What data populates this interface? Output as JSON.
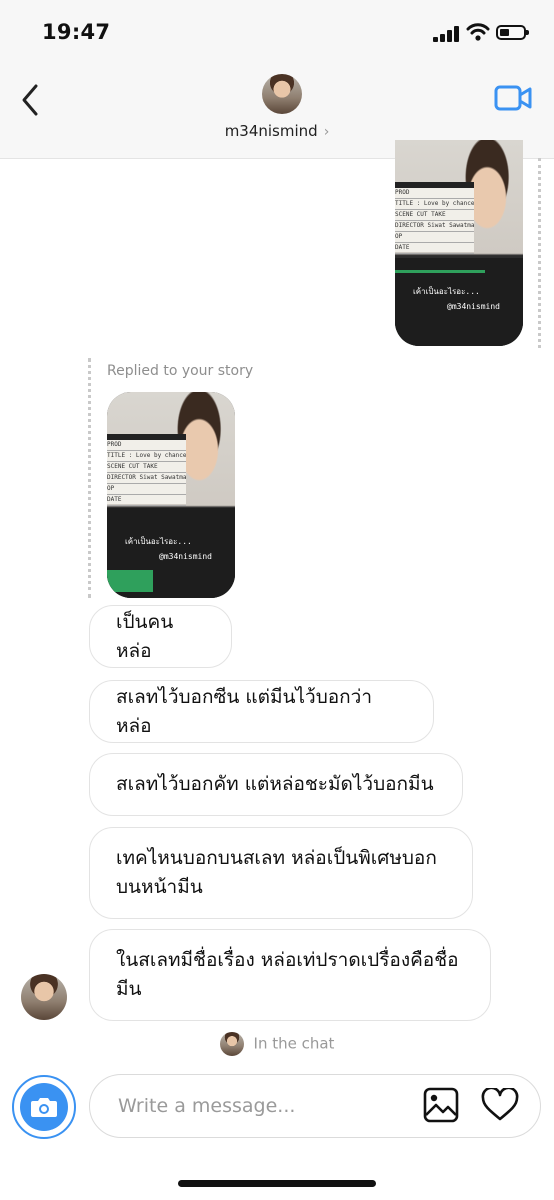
{
  "status_bar": {
    "time": "19:47"
  },
  "header": {
    "username": "m34nismind",
    "chevron": "›"
  },
  "sent_story": {
    "clap_lines": [
      "PROD",
      "TITLE : Love by chance บังเอิญรัก",
      "SCENE  CUT  TAKE",
      "DIRECTOR  Siwat Sawatmaneekul",
      "OP",
      "DATE"
    ],
    "overlay_text": "เค้าเป็นอะไรอะ...",
    "tag": "@m34nismind"
  },
  "reply": {
    "label": "Replied to your story",
    "story": {
      "clap_lines": [
        "PROD",
        "TITLE : Love by chance บังเอิญรัก",
        "SCENE  CUT  TAKE",
        "DIRECTOR  Siwat Sawatmaneekul",
        "OP",
        "DATE"
      ],
      "overlay_text": "เค้าเป็นอะไรอะ...",
      "tag": "@m34nismind"
    }
  },
  "messages": [
    {
      "lines": [
        "เป็นคนหล่อ"
      ]
    },
    {
      "lines": [
        "สเลทไว้บอกซีน แต่มีนไว้บอกว่าหล่อ"
      ]
    },
    {
      "lines": [
        "สเลทไว้บอกคัท แต่หล่อชะมัดไว้บอกมีน"
      ]
    },
    {
      "lines": [
        "เทคไหนบอกบนสเลท หล่อเป็นพิเศษบอก",
        "บนหน้ามีน"
      ]
    },
    {
      "lines": [
        "ในสเลทมีชื่อเรื่อง หล่อเท่ปราดเปรื่องคือชื่อ",
        "มีน"
      ]
    }
  ],
  "in_chat_label": "In the chat",
  "composer": {
    "placeholder": "Write a message..."
  },
  "colors": {
    "accent": "#3a92f2",
    "bubble_border": "#e3e3e3",
    "muted_text": "#8e8e8e"
  },
  "icons": [
    "back-arrow-icon",
    "video-camera-icon",
    "camera-icon",
    "gallery-icon",
    "heart-icon"
  ]
}
